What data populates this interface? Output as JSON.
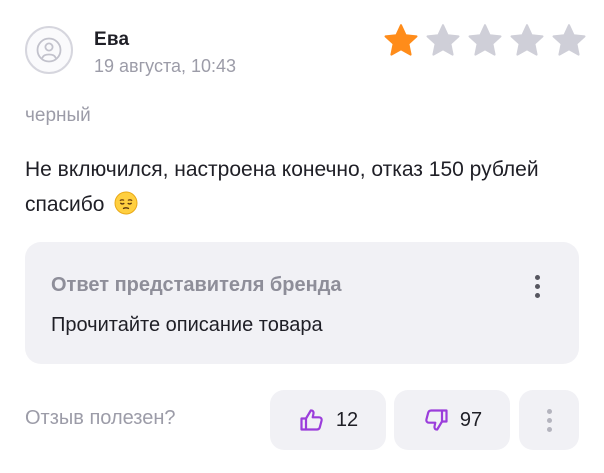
{
  "review": {
    "author": "Ева",
    "date": "19 августа, 10:43",
    "rating": 1,
    "rating_max": 5,
    "variant": "черный",
    "text": "Не включился, настроена конечно, отказ 150 рублей спасибо",
    "emoji": "pensive-face"
  },
  "brand_reply": {
    "title": "Ответ представителя бренда",
    "text": "Прочитайте описание товара",
    "menu_icon": "more-vertical-icon"
  },
  "footer": {
    "helpful_label": "Отзыв полезен?",
    "likes": "12",
    "dislikes": "97",
    "like_icon": "thumbs-up-icon",
    "dislike_icon": "thumbs-down-icon",
    "more_icon": "more-vertical-icon"
  },
  "colors": {
    "star_active": "#ff8c1a",
    "star_inactive": "#cfcfd8",
    "accent": "#9b3ddb",
    "muted_text": "#9c9ca8",
    "panel_bg": "#f1f1f5"
  }
}
